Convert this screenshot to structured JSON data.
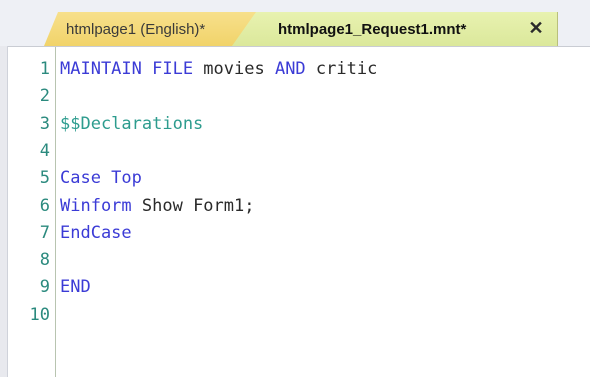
{
  "tabs": [
    {
      "label": "htmlpage1 (English)*"
    },
    {
      "label": "htmlpage1_Request1.mnt*",
      "close": "✕"
    }
  ],
  "editor": {
    "line_numbers": [
      "1",
      "2",
      "3",
      "4",
      "5",
      "6",
      "7",
      "8",
      "9",
      "10"
    ],
    "lines": [
      [
        {
          "t": "MAINTAIN FILE",
          "c": "kw"
        },
        {
          "t": " movies ",
          "c": "tx"
        },
        {
          "t": "AND",
          "c": "kw"
        },
        {
          "t": " critic",
          "c": "tx"
        }
      ],
      [],
      [
        {
          "t": "$$Declarations",
          "c": "pp"
        }
      ],
      [],
      [
        {
          "t": "Case Top",
          "c": "kw"
        }
      ],
      [
        {
          "t": "Winform",
          "c": "kw"
        },
        {
          "t": " Show Form1;",
          "c": "tx"
        }
      ],
      [
        {
          "t": "EndCase",
          "c": "kw"
        }
      ],
      [],
      [
        {
          "t": "END",
          "c": "kw"
        }
      ],
      []
    ]
  },
  "colors": {
    "keyword": "#3b3bd6",
    "text": "#2a2a2a",
    "preprocessor": "#2d9c8e",
    "line_number": "#2b8a7e",
    "tab_inactive": "#f1d36a",
    "tab_active": "#dbe89b"
  }
}
